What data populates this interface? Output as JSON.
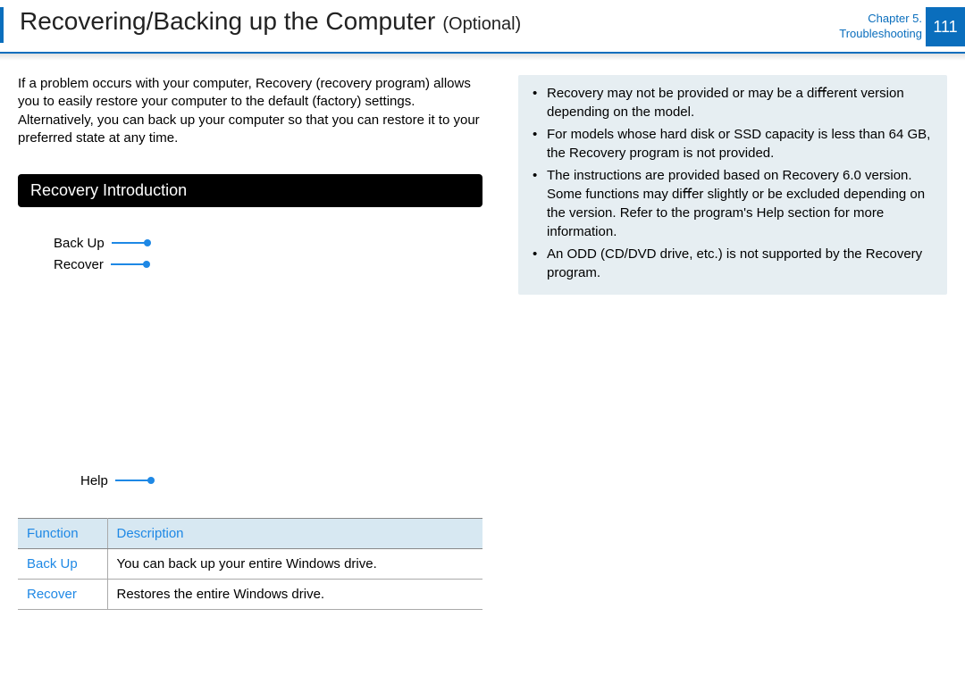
{
  "header": {
    "title": "Recovering/Backing up the Computer",
    "subtitle": "(Optional)",
    "chapter_line1": "Chapter 5.",
    "chapter_line2": "Troubleshooting",
    "page_number": "111"
  },
  "intro": "If a problem occurs with your computer, Recovery (recovery program) allows you to easily restore your computer to the default (factory) settings. Alternatively, you can back up your computer so that you can restore it to your preferred state at any time.",
  "section_heading": "Recovery Introduction",
  "diagram": {
    "backup": "Back Up",
    "recover": "Recover",
    "help": "Help"
  },
  "table": {
    "head_function": "Function",
    "head_description": "Description",
    "rows": [
      {
        "fn": "Back Up",
        "desc": "You can back up your entire Windows drive."
      },
      {
        "fn": "Recover",
        "desc": "Restores the entire Windows drive."
      }
    ]
  },
  "notes": [
    "Recovery may not be provided or may be a diﬀerent version depending on the model.",
    "For models whose hard disk or SSD capacity is less than 64 GB, the Recovery program is not provided.",
    "The instructions are provided based on Recovery 6.0 version. Some functions may diﬀer slightly or be excluded depending on the version. Refer to the program's Help section for more information.",
    "An ODD (CD/DVD drive, etc.) is not supported by the Recovery program."
  ]
}
